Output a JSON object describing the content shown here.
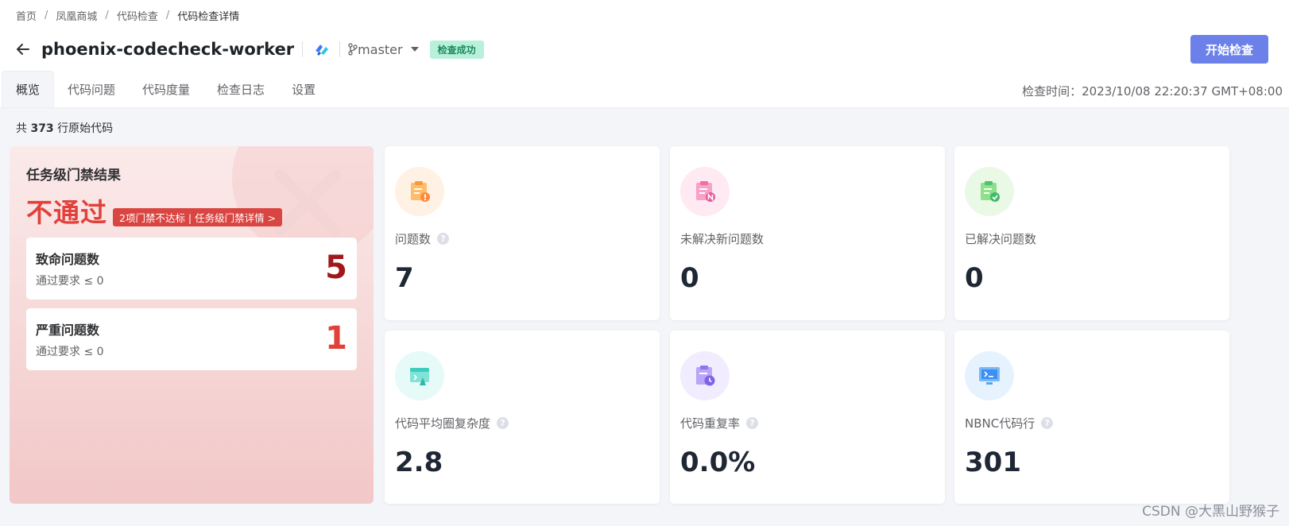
{
  "breadcrumb": [
    "首页",
    "凤凰商城",
    "代码检查",
    "代码检查详情"
  ],
  "breadcrumb_sep": "/",
  "repo": {
    "name": "phoenix-codecheck-worker",
    "branch": "master",
    "status": "检查成功"
  },
  "start_button": "开始检查",
  "tabs": [
    "概览",
    "代码问题",
    "代码度量",
    "检查日志",
    "设置"
  ],
  "check_time": "检查时间：2023/10/08 22:20:37 GMT+08:00",
  "line_count": {
    "prefix": "共",
    "value": "373",
    "suffix": "行原始代码"
  },
  "gate": {
    "title": "任务级门禁结果",
    "result": "不通过",
    "detail": "2项门禁不达标 | 任务级门禁详情  >",
    "items": [
      {
        "title": "致命问题数",
        "requirement": "通过要求 ≤ 0",
        "value": "5",
        "color": "#a3171b"
      },
      {
        "title": "严重问题数",
        "requirement": "通过要求 ≤ 0",
        "value": "1",
        "color": "#e0413a"
      }
    ]
  },
  "metrics": [
    {
      "label": "问题数",
      "value": "7",
      "help": true,
      "icon": "issue-warning-icon"
    },
    {
      "label": "未解决新问题数",
      "value": "0",
      "help": false,
      "icon": "new-issue-icon"
    },
    {
      "label": "已解决问题数",
      "value": "0",
      "help": false,
      "icon": "resolved-check-icon"
    },
    {
      "label": "代码平均圈复杂度",
      "value": "2.8",
      "help": true,
      "icon": "complexity-icon"
    },
    {
      "label": "代码重复率",
      "value": "0.0%",
      "help": true,
      "icon": "duplicate-clock-icon"
    },
    {
      "label": "NBNC代码行",
      "value": "301",
      "help": true,
      "icon": "code-lines-monitor-icon"
    }
  ],
  "help_glyph": "?",
  "watermark": "CSDN @大黑山野猴子",
  "colors": {
    "accent": "#6b80e8",
    "danger": "#e0413a",
    "success_bg": "#b9f0dc",
    "success_text": "#1c8b5a"
  }
}
